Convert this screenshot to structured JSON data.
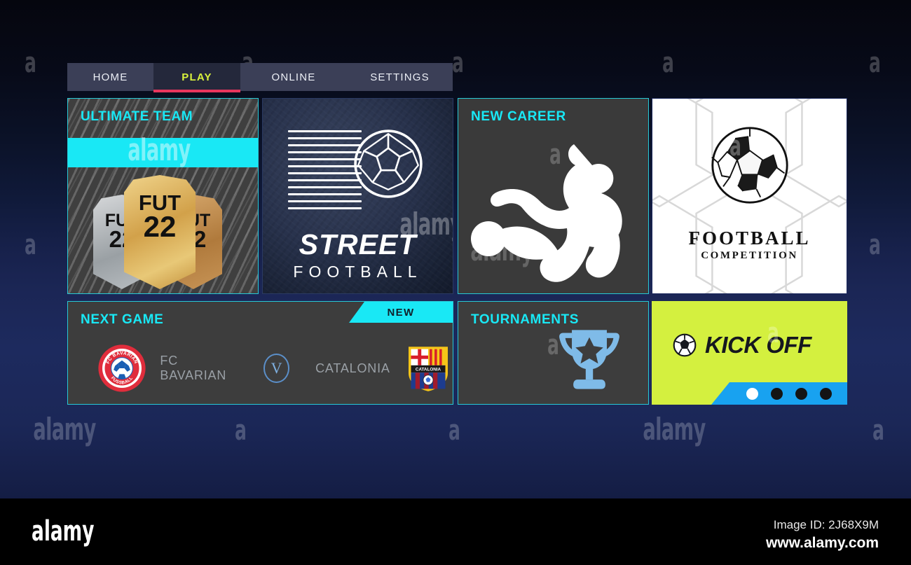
{
  "nav": {
    "tabs": [
      {
        "id": "home",
        "label": "HOME",
        "active": false
      },
      {
        "id": "play",
        "label": "PLAY",
        "active": true
      },
      {
        "id": "online",
        "label": "ONLINE",
        "active": false
      },
      {
        "id": "settings",
        "label": "SETTINGS",
        "active": false
      }
    ],
    "active_underline_color": "#e8365d",
    "active_text_color": "#d9f23c"
  },
  "tiles": {
    "ultimate_team": {
      "title": "ULTIMATE TEAM",
      "cards": [
        {
          "type": "silver",
          "line1": "FUT",
          "line2": "22"
        },
        {
          "type": "gold",
          "line1": "FUT",
          "line2": "22"
        },
        {
          "type": "bronze",
          "line1": "FUT",
          "line2": "22"
        }
      ]
    },
    "street_football": {
      "title_main": "STREET",
      "title_sub": "FOOTBALL"
    },
    "new_career": {
      "title": "NEW CAREER",
      "icon": "player-kicking-silhouette"
    },
    "football_competition": {
      "title_main": "FOOTBALL",
      "title_sub": "COMPETITION",
      "icon": "soccer-ball"
    },
    "next_game": {
      "title": "NEXT GAME",
      "badge": "NEW",
      "home_team": "FC BAVARIAN",
      "away_team": "CATALONIA",
      "versus": "V",
      "home_crest_text_top": "FC BAVARIAN",
      "home_crest_text_bottom": "FUSSBALL",
      "away_crest_text": "CATALONIA"
    },
    "tournaments": {
      "title": "TOURNAMENTS",
      "icon": "trophy-star-icon"
    },
    "kick_off": {
      "label": "KICK OFF",
      "icon": "soccer-ball-icon",
      "dots": [
        true,
        false,
        false,
        false
      ]
    }
  },
  "colors": {
    "accent_cyan": "#19e8f5",
    "tile_border": "#27c9d6",
    "lime": "#d4f03f",
    "carousel_blue": "#18a2f0",
    "nav_bar": "#3b3f57"
  },
  "watermarks": {
    "word": "alamy",
    "letter": "a"
  },
  "footer": {
    "logo": "alamy",
    "image_id": "Image ID: 2J68X9M",
    "url": "www.alamy.com"
  }
}
